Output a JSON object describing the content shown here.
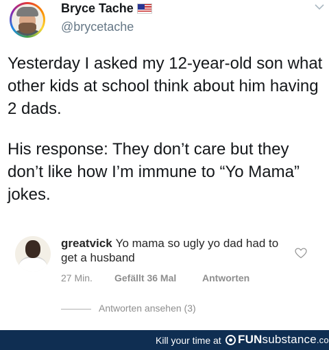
{
  "tweet": {
    "display_name": "Bryce Tache",
    "handle": "@brycetache",
    "flag_icon": "us-flag-emoji",
    "avatar_icon": "user-avatar-rainbow-ring",
    "menu_icon": "chevron-down-icon",
    "paragraphs": [
      "Yesterday I asked my 12-year-old son what other kids at school think about him having 2 dads.",
      "His response: They don’t care but they don’t like how I’m immune to “Yo Mama” jokes."
    ]
  },
  "comment": {
    "username": "greatvick",
    "text": "Yo mama so ugly yo dad had to get a husband",
    "time": "27 Min.",
    "likes": "Gefällt 36 Mal",
    "reply": "Antworten",
    "view_replies": "Antworten ansehen (3)",
    "like_icon": "heart-outline-icon"
  },
  "footer": {
    "tagline": "Kill your time at",
    "brand_fun": "FUN",
    "brand_sub": "substance",
    "brand_domain": ".com",
    "background": "#0f2e52"
  }
}
